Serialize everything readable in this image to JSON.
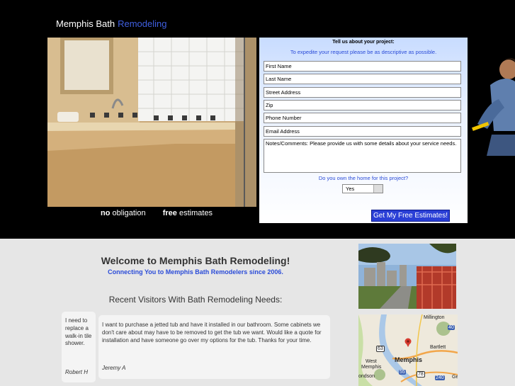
{
  "header": {
    "brand_main": "Memphis Bath",
    "brand_highlight": "Remodeling"
  },
  "hero": {
    "tag_bold_1": "no",
    "tag_text_1": "obligation",
    "tag_bold_2": "free",
    "tag_text_2": "estimates"
  },
  "form": {
    "title": "Tell us about your project:",
    "subtitle": "To expedite your request please be as descriptive as possible.",
    "fields": {
      "first_name": "First Name",
      "last_name": "Last Name",
      "street": "Street Address",
      "zip": "Zip",
      "phone": "Phone Number",
      "email": "Email Address",
      "notes": "Notes/Comments: Please provide us with some details about your service needs."
    },
    "own_question": "Do you own the home for this project?",
    "own_value": "Yes",
    "submit_label": "Get My Free Estimates!"
  },
  "main": {
    "welcome": "Welcome to Memphis Bath Remodeling!",
    "connecting": "Connecting You to Memphis Bath Remodelers since 2006.",
    "recent_title": "Recent Visitors With Bath Remodeling Needs:"
  },
  "testimonials": [
    {
      "text": "I need to replace a walk-in tile shower.",
      "author": "Robert H"
    },
    {
      "text": "I want to purchase a jetted tub and have it installed in our bathroom. Some cabinets we don't care about may have to be removed to get the tub we want. Would like a quote for installation and have someone go over my options for the tub. Thanks for your time.",
      "author": "Jeremy A"
    }
  ],
  "map": {
    "labels": {
      "millington": "Millington",
      "bartlett": "Bartlett",
      "memphis": "Memphis",
      "west_memphis_1": "West",
      "west_memphis_2": "Memphis",
      "ondson": "ondson",
      "ge": "Ge"
    },
    "shields": [
      "40",
      "63",
      "55",
      "78",
      "240"
    ]
  }
}
